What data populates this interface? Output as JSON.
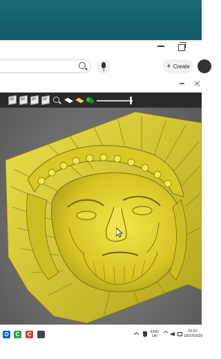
{
  "browser": {
    "create_label": "Create",
    "create_plus": "+"
  },
  "viewer": {
    "toolbar_icons": [
      "cube-view-icon",
      "cube-view-icon",
      "cube-view-icon",
      "cube-view-icon",
      "zoom-icon",
      "flat-shade-icon",
      "gold-shade-icon",
      "color-ball-icon"
    ],
    "model_color": "#e3d42a",
    "background_color": "#6f6f6f"
  },
  "taskbar": {
    "apps": [
      {
        "name": "outlook-icon",
        "glyph": "O",
        "color": "#0a64c8"
      },
      {
        "name": "camtasia-icon",
        "glyph": "C",
        "color": "#2ea043"
      },
      {
        "name": "camtasia-rec-icon",
        "glyph": "C",
        "color": "#d73a3a"
      },
      {
        "name": "artcam-icon",
        "glyph": "",
        "color": "#444444"
      }
    ],
    "lang_line1": "ENG",
    "lang_line2": "UK",
    "clock_time": "10:07",
    "clock_date": "18/07/2025"
  }
}
